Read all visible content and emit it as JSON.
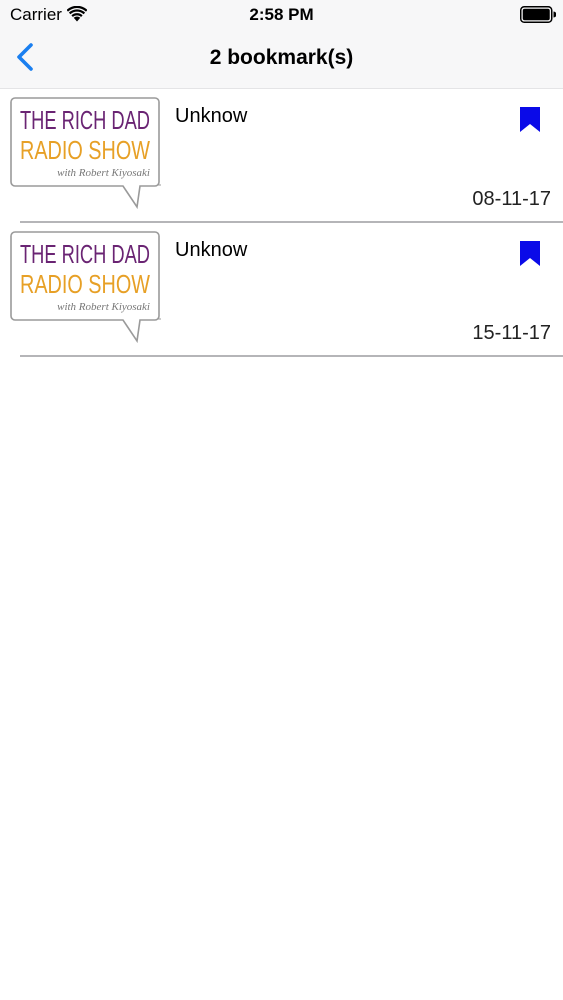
{
  "status_bar": {
    "carrier": "Carrier",
    "time": "2:58 PM"
  },
  "nav": {
    "title": "2 bookmark(s)",
    "back_icon": "chevron-left-icon",
    "tint_color": "#1a7ff0"
  },
  "logo": {
    "line1": "THE RICH DAD",
    "line2": "RADIO SHOW",
    "line3": "with Robert Kiyosaki",
    "line1_color": "#6a2473",
    "line2_color": "#e7a026",
    "line3_color": "#777777"
  },
  "bookmarks": [
    {
      "title": "Unknow",
      "date": "08-11-17",
      "icon": "bookmark-icon"
    },
    {
      "title": "Unknow",
      "date": "15-11-17",
      "icon": "bookmark-icon"
    }
  ],
  "colors": {
    "bookmark": "#0a0ae8",
    "separator": "#b5b5b8"
  }
}
